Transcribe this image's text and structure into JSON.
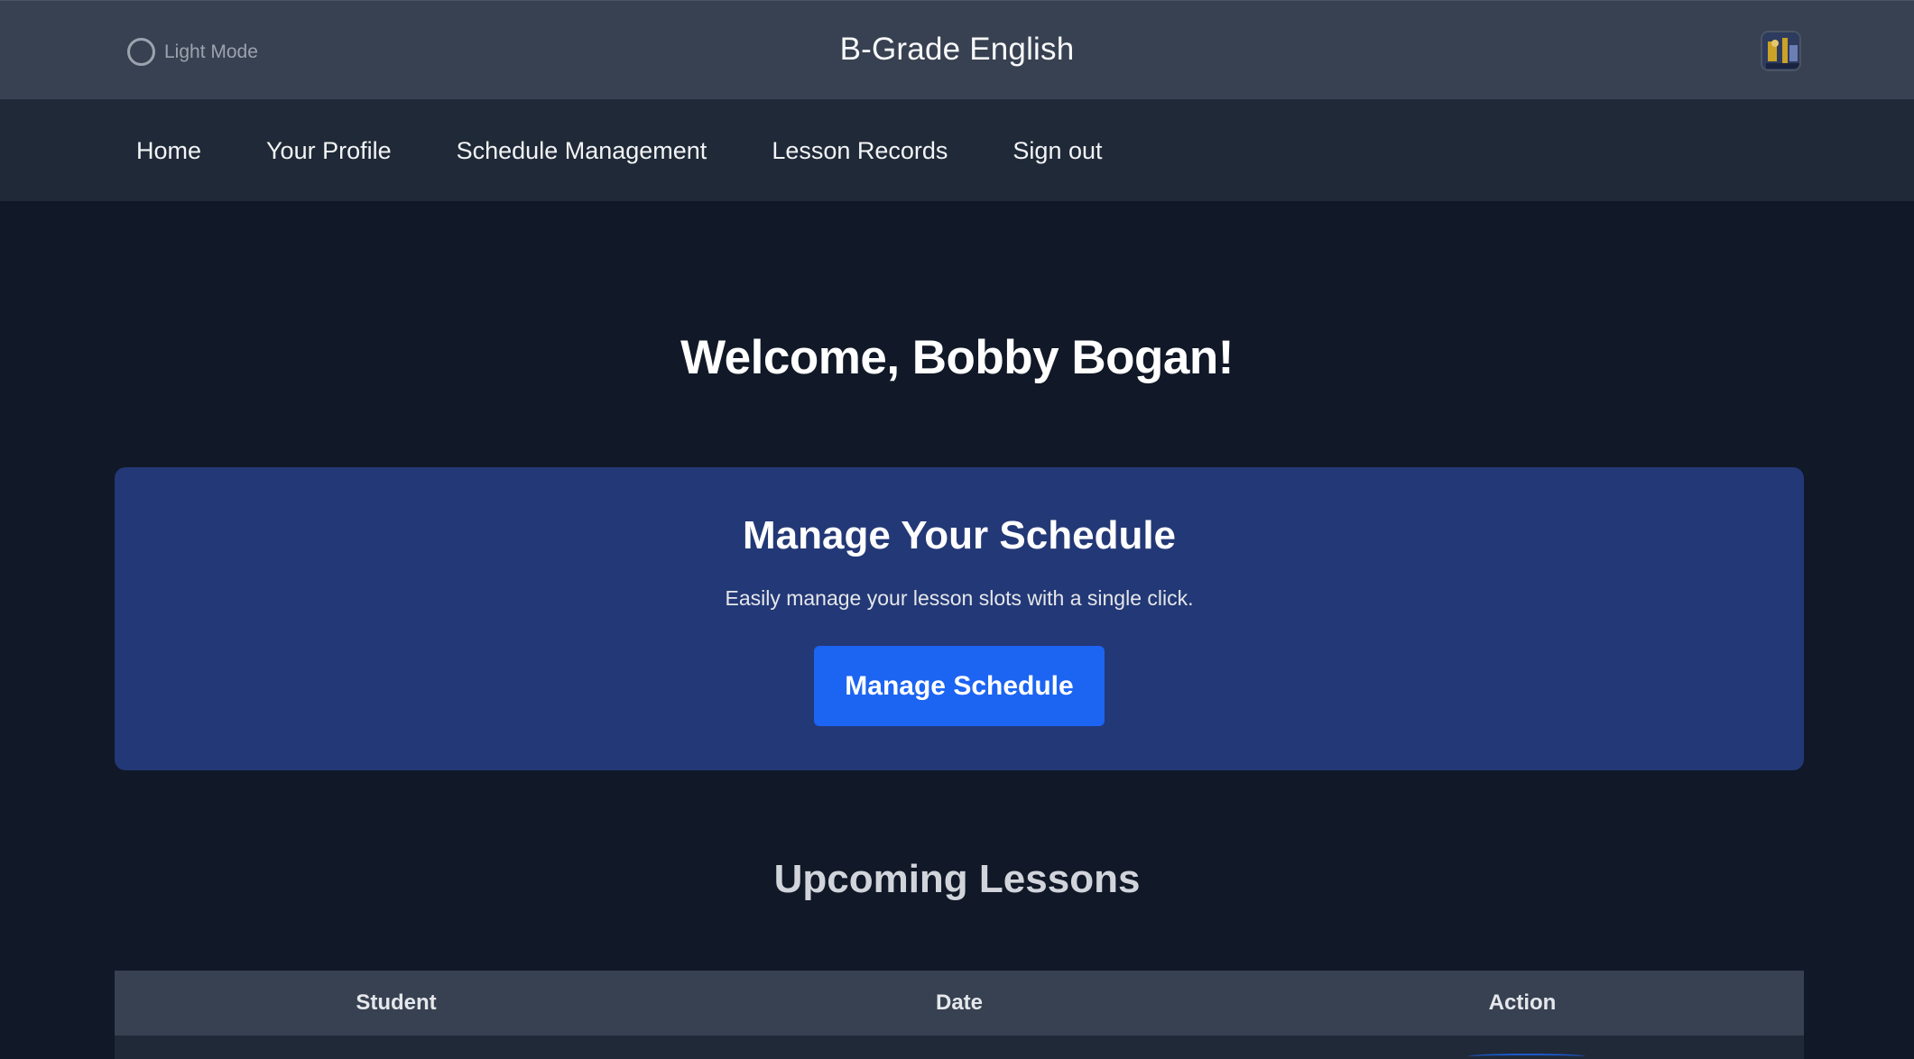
{
  "header": {
    "mode_toggle_label": "Light Mode",
    "site_title": "B-Grade English",
    "avatar_icon": "user-avatar-icon"
  },
  "nav": {
    "items": [
      {
        "label": "Home"
      },
      {
        "label": "Your Profile"
      },
      {
        "label": "Schedule Management"
      },
      {
        "label": "Lesson Records"
      },
      {
        "label": "Sign out"
      }
    ]
  },
  "main": {
    "welcome": "Welcome, Bobby Bogan!",
    "schedule_card": {
      "title": "Manage Your Schedule",
      "subtitle": "Easily manage your lesson slots with a single click.",
      "button_label": "Manage Schedule"
    },
    "upcoming": {
      "title": "Upcoming Lessons",
      "columns": [
        "Student",
        "Date",
        "Action"
      ]
    }
  },
  "colors": {
    "page_bg": "#111827",
    "header_bg": "#374151",
    "nav_bg": "#1f2937",
    "card_bg": "#233876",
    "accent": "#1c64f2"
  }
}
